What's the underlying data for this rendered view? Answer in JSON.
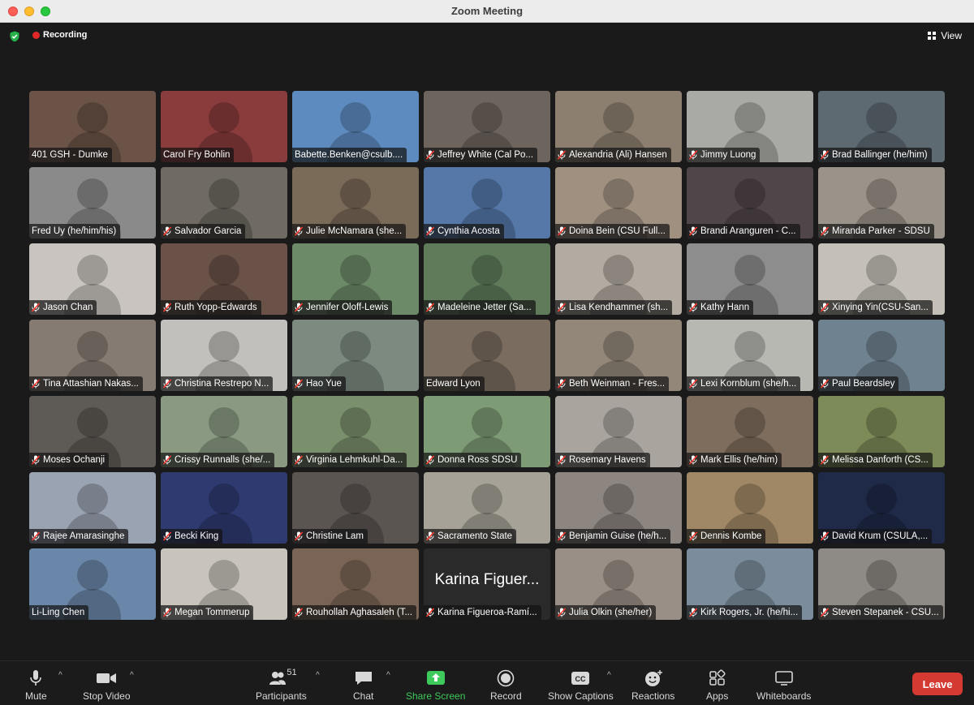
{
  "window": {
    "title": "Zoom Meeting"
  },
  "top": {
    "recording_label": "Recording",
    "view_label": "View"
  },
  "participants": [
    {
      "name": "401 GSH - Dumke",
      "muted": false,
      "bg": "#6b5347"
    },
    {
      "name": "Carol Fry Bohlin",
      "muted": false,
      "bg": "#8a3b3b"
    },
    {
      "name": "Babette.Benken@csulb....",
      "muted": false,
      "bg": "#5d8bbf"
    },
    {
      "name": "Jeffrey White (Cal Po...",
      "muted": true,
      "bg": "#6d645e"
    },
    {
      "name": "Alexandria (Ali) Hansen",
      "muted": true,
      "bg": "#8c7f70"
    },
    {
      "name": "Jimmy Luong",
      "muted": true,
      "bg": "#a9a9a5"
    },
    {
      "name": "Brad Ballinger (he/him)",
      "muted": true,
      "bg": "#5e6a72"
    },
    {
      "name": "Fred Uy (he/him/his)",
      "muted": false,
      "bg": "#8a8a8a"
    },
    {
      "name": "Salvador Garcia",
      "muted": true,
      "bg": "#6f6a62"
    },
    {
      "name": "Julie McNamara (she...",
      "muted": true,
      "bg": "#7a6a58"
    },
    {
      "name": "Cynthia Acosta",
      "muted": true,
      "bg": "#5578a8"
    },
    {
      "name": "Doina Bein (CSU Full...",
      "muted": true,
      "bg": "#a09080"
    },
    {
      "name": "Brandi Aranguren - C...",
      "muted": true,
      "bg": "#50464a"
    },
    {
      "name": "Miranda Parker - SDSU",
      "muted": true,
      "bg": "#9a938a"
    },
    {
      "name": "Jason Chan",
      "muted": true,
      "bg": "#c9c4bf"
    },
    {
      "name": "Ruth Yopp-Edwards",
      "muted": true,
      "bg": "#6a5248"
    },
    {
      "name": "Jennifer Oloff-Lewis",
      "muted": true,
      "bg": "#6d8a68"
    },
    {
      "name": "Madeleine Jetter (Sa...",
      "muted": true,
      "bg": "#5f7b5a"
    },
    {
      "name": "Lisa Kendhammer (sh...",
      "muted": true,
      "bg": "#b2aba2"
    },
    {
      "name": "Kathy Hann",
      "muted": true,
      "bg": "#8d8d8d"
    },
    {
      "name": "Xinying Yin(CSU-San...",
      "muted": true,
      "bg": "#c4c0b8"
    },
    {
      "name": "Tina Attashian Nakas...",
      "muted": true,
      "bg": "#867b72"
    },
    {
      "name": "Christina Restrepo N...",
      "muted": true,
      "bg": "#c2c0bc"
    },
    {
      "name": "Hao Yue",
      "muted": true,
      "bg": "#7c8a80"
    },
    {
      "name": "Edward Lyon",
      "muted": false,
      "bg": "#7a6c5e"
    },
    {
      "name": "Beth Weinman - Fres...",
      "muted": true,
      "bg": "#93877a"
    },
    {
      "name": "Lexi Kornblum (she/h...",
      "muted": true,
      "bg": "#b8b8b2"
    },
    {
      "name": "Paul Beardsley",
      "muted": true,
      "bg": "#6f8290"
    },
    {
      "name": "Moses Ochanji",
      "muted": true,
      "bg": "#5e5a55"
    },
    {
      "name": "Crissy Runnalls (she/...",
      "muted": true,
      "bg": "#8a9a82"
    },
    {
      "name": "Virginia Lehmkuhl-Da...",
      "muted": true,
      "bg": "#7a8f6c"
    },
    {
      "name": "Donna Ross SDSU",
      "muted": true,
      "bg": "#7d9b74"
    },
    {
      "name": "Rosemary Havens",
      "muted": true,
      "bg": "#a9a49e"
    },
    {
      "name": "Mark Ellis (he/him)",
      "muted": true,
      "bg": "#7e6d5c"
    },
    {
      "name": "Melissa Danforth (CS...",
      "muted": true,
      "bg": "#7d8b58"
    },
    {
      "name": "Rajee Amarasinghe",
      "muted": true,
      "bg": "#9aa3b2"
    },
    {
      "name": "Becki King",
      "muted": true,
      "bg": "#2e3a70"
    },
    {
      "name": "Christine Lam",
      "muted": true,
      "bg": "#5b5552"
    },
    {
      "name": "Sacramento State",
      "muted": true,
      "bg": "#a6a298"
    },
    {
      "name": "Benjamin Guise (he/h...",
      "muted": true,
      "bg": "#8c8580"
    },
    {
      "name": "Dennis Kombe",
      "muted": true,
      "bg": "#a08866"
    },
    {
      "name": "David Krum (CSULA,...",
      "muted": true,
      "bg": "#1f2a48"
    },
    {
      "name": "Li-Ling Chen",
      "muted": false,
      "bg": "#6a86a8"
    },
    {
      "name": "Megan Tommerup",
      "muted": true,
      "bg": "#c8c3bb"
    },
    {
      "name": "Rouhollah Aghasaleh (T...",
      "muted": true,
      "bg": "#7a6455"
    },
    {
      "name": "Karina Figueroa-Ramí...",
      "muted": true,
      "bg": "#2a2a2a",
      "big": "Karina Figuer..."
    },
    {
      "name": "Julia Olkin (she/her)",
      "muted": true,
      "bg": "#9a8f86"
    },
    {
      "name": "Kirk Rogers, Jr. (he/hi...",
      "muted": true,
      "bg": "#7b8d9c"
    },
    {
      "name": "Steven Stepanek - CSU...",
      "muted": true,
      "bg": "#8e8a85"
    }
  ],
  "toolbar": {
    "mute": "Mute",
    "stop_video": "Stop Video",
    "participants": "Participants",
    "participants_count": "51",
    "chat": "Chat",
    "share_screen": "Share Screen",
    "record": "Record",
    "show_captions": "Show Captions",
    "reactions": "Reactions",
    "apps": "Apps",
    "whiteboards": "Whiteboards",
    "leave": "Leave"
  },
  "colors": {
    "accent_green": "#3ec95b",
    "leave_red": "#d53a32",
    "rec_red": "#e02828"
  }
}
